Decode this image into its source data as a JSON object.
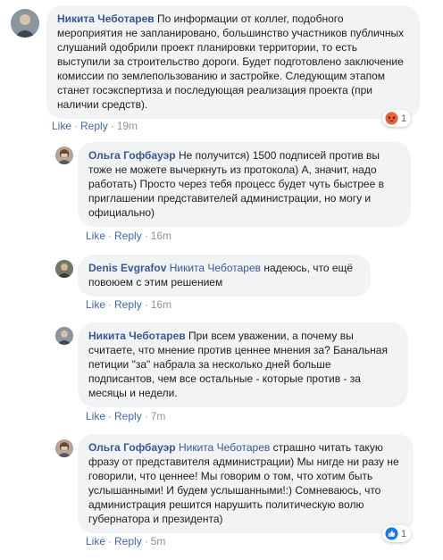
{
  "comments": [
    {
      "author": "Никита Чеботарев",
      "mention": "",
      "text": "По информации от коллег, подобного мероприятия не запланировано, большинство участников публичных слушаний одобрили проект планировки территории, то есть выступили за строительство дороги. Будет подготовлено заключение комиссии по землепользованию и застройке. Следующим этапом станет госэкспертиза и последующая реализация проекта (при наличии средств).",
      "like": "Like",
      "reply": "Reply",
      "time": "19m",
      "reaction": {
        "icon": "angry-icon",
        "count": "1"
      }
    },
    {
      "author": "Ольга Гофбауэр",
      "mention": "",
      "text": "Не получится) 1500 подписей против вы тоже не можете вычеркнуть из протокола) А, значит, надо работать) Просто через тебя процесс будет чуть быстрее в приглашении представителей администрации, но могу и официально)",
      "like": "Like",
      "reply": "Reply",
      "time": "16m"
    },
    {
      "author": "Denis Evgrafov",
      "mention": "Никита Чеботарев",
      "text": "надеюсь, что ещё повоюем с этим решением",
      "like": "Like",
      "reply": "Reply",
      "time": "16m"
    },
    {
      "author": "Никита Чеботарев",
      "mention": "",
      "text": "При всем уважении, а почему вы считаете, что мнение против ценнее мнения за? Банальная петиции \"за\" набрала за несколько дней больше подписантов, чем все остальные - которые против - за месяцы и недели.",
      "like": "Like",
      "reply": "Reply",
      "time": "7m"
    },
    {
      "author": "Ольга Гофбауэр",
      "mention": "Никита Чеботарев",
      "text": "страшно читать такую фразу от представителя администрации) Мы нигде ни разу не говорили, что ценнее! Мы говорим о том, что хотим быть услышанными! И будем услышанными!:) Сомневаюсь, что администрация решится нарушить политическую волю губернатора и президента)",
      "like": "Like",
      "reply": "Reply",
      "time": "5m",
      "reaction": {
        "icon": "like-icon",
        "count": "1"
      }
    }
  ],
  "colors": {
    "bubble": "#f2f3f5",
    "author": "#385898",
    "link": "#4267b2",
    "meta": "#90949c"
  }
}
